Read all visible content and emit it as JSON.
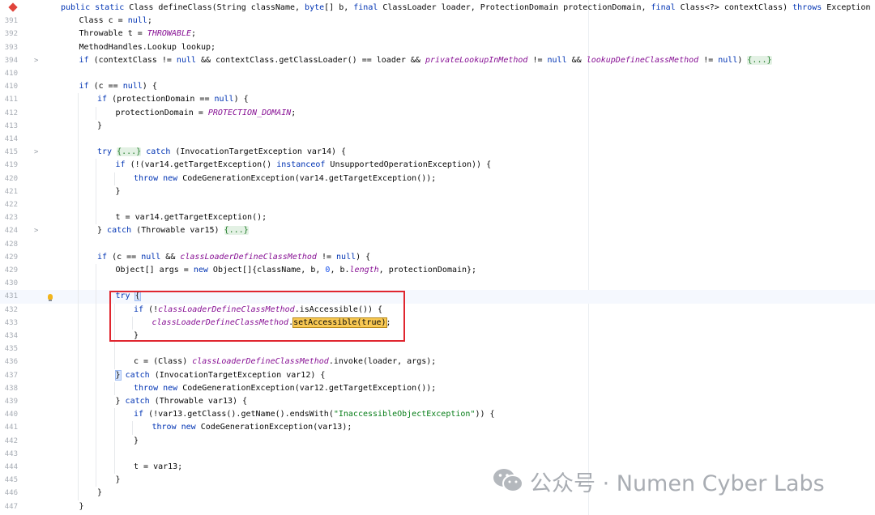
{
  "editor": {
    "language": "Java",
    "lines": [
      {
        "n": "",
        "segs": [
          [
            "kw",
            "public static "
          ],
          [
            "",
            "Class defineClass(String className, "
          ],
          [
            "kw",
            "byte"
          ],
          [
            "",
            "[] b, "
          ],
          [
            "kw",
            "final "
          ],
          [
            "",
            "ClassLoader loader, ProtectionDomain protectionDomain, "
          ],
          [
            "kw",
            "final "
          ],
          [
            "",
            "Class<?> contextClass) "
          ],
          [
            "kw",
            "throws "
          ],
          [
            "",
            "Exception {"
          ]
        ],
        "indent": 0
      },
      {
        "n": "391",
        "segs": [
          [
            "",
            "Class c = "
          ],
          [
            "kw",
            "null"
          ],
          [
            "",
            ";"
          ]
        ],
        "indent": 1
      },
      {
        "n": "392",
        "segs": [
          [
            "",
            "Throwable t = "
          ],
          [
            "const",
            "THROWABLE"
          ],
          [
            "",
            ";"
          ]
        ],
        "indent": 1
      },
      {
        "n": "393",
        "segs": [
          [
            "",
            "MethodHandles.Lookup lookup;"
          ]
        ],
        "indent": 1
      },
      {
        "n": "394",
        "fold": ">",
        "segs": [
          [
            "kw",
            "if "
          ],
          [
            "",
            "(contextClass != "
          ],
          [
            "kw",
            "null "
          ],
          [
            "",
            "&& contextClass.getClassLoader() == loader && "
          ],
          [
            "fld",
            "privateLookupInMethod"
          ],
          [
            "",
            " != "
          ],
          [
            "kw",
            "null "
          ],
          [
            "",
            "&& "
          ],
          [
            "fld",
            "lookupDefineClassMethod"
          ],
          [
            "",
            " != "
          ],
          [
            "kw",
            "null"
          ],
          [
            "",
            ") "
          ],
          [
            "fold",
            "{...}"
          ]
        ],
        "indent": 1
      },
      {
        "n": "410",
        "segs": [],
        "indent": 1
      },
      {
        "n": "410",
        "segs": [
          [
            "kw",
            "if "
          ],
          [
            "",
            "(c == "
          ],
          [
            "kw",
            "null"
          ],
          [
            "",
            ") {"
          ]
        ],
        "indent": 1
      },
      {
        "n": "411",
        "segs": [
          [
            "kw",
            "if "
          ],
          [
            "",
            "(protectionDomain == "
          ],
          [
            "kw",
            "null"
          ],
          [
            "",
            ") {"
          ]
        ],
        "indent": 2
      },
      {
        "n": "412",
        "segs": [
          [
            "",
            "protectionDomain = "
          ],
          [
            "const",
            "PROTECTION_DOMAIN"
          ],
          [
            "",
            ";"
          ]
        ],
        "indent": 3
      },
      {
        "n": "413",
        "segs": [
          [
            "",
            "}"
          ]
        ],
        "indent": 2
      },
      {
        "n": "414",
        "segs": [],
        "indent": 2
      },
      {
        "n": "415",
        "fold": ">",
        "segs": [
          [
            "kw",
            "try "
          ],
          [
            "fold",
            "{...}"
          ],
          [
            "",
            " "
          ],
          [
            "kw",
            "catch "
          ],
          [
            "",
            "(InvocationTargetException var14) {"
          ]
        ],
        "indent": 2
      },
      {
        "n": "419",
        "segs": [
          [
            "kw",
            "if "
          ],
          [
            "",
            "(!(var14.getTargetException() "
          ],
          [
            "kw",
            "instanceof "
          ],
          [
            "",
            "UnsupportedOperationException)) {"
          ]
        ],
        "indent": 3
      },
      {
        "n": "420",
        "segs": [
          [
            "kw",
            "throw new "
          ],
          [
            "",
            "CodeGenerationException(var14.getTargetException());"
          ]
        ],
        "indent": 4
      },
      {
        "n": "421",
        "segs": [
          [
            "",
            "}"
          ]
        ],
        "indent": 3
      },
      {
        "n": "422",
        "segs": [],
        "indent": 3
      },
      {
        "n": "423",
        "segs": [
          [
            "",
            "t = var14.getTargetException();"
          ]
        ],
        "indent": 3
      },
      {
        "n": "424",
        "fold": ">",
        "segs": [
          [
            "",
            "} "
          ],
          [
            "kw",
            "catch "
          ],
          [
            "",
            "(Throwable var15) "
          ],
          [
            "fold",
            "{...}"
          ]
        ],
        "indent": 2
      },
      {
        "n": "428",
        "segs": [],
        "indent": 2
      },
      {
        "n": "429",
        "segs": [
          [
            "kw",
            "if "
          ],
          [
            "",
            "(c == "
          ],
          [
            "kw",
            "null "
          ],
          [
            "",
            "&& "
          ],
          [
            "fld",
            "classLoaderDefineClassMethod"
          ],
          [
            "",
            " != "
          ],
          [
            "kw",
            "null"
          ],
          [
            "",
            ") {"
          ]
        ],
        "indent": 2
      },
      {
        "n": "429",
        "segs": [
          [
            "",
            "Object[] args = "
          ],
          [
            "kw",
            "new "
          ],
          [
            "",
            "Object[]{className, b, "
          ],
          [
            "num",
            "0"
          ],
          [
            "",
            ", b."
          ],
          [
            "fld",
            "length"
          ],
          [
            "",
            ", protectionDomain};"
          ]
        ],
        "indent": 3
      },
      {
        "n": "430",
        "segs": [],
        "indent": 3
      },
      {
        "n": "431",
        "current": true,
        "bulb": true,
        "segs": [
          [
            "kw",
            "try "
          ],
          [
            "brace",
            "{"
          ]
        ],
        "indent": 3
      },
      {
        "n": "432",
        "segs": [
          [
            "kw",
            "if "
          ],
          [
            "",
            "(!"
          ],
          [
            "fld",
            "classLoaderDefineClassMethod"
          ],
          [
            "",
            ".isAccessible()) {"
          ]
        ],
        "indent": 4
      },
      {
        "n": "433",
        "segs": [
          [
            "fld",
            "classLoaderDefineClassMethod"
          ],
          [
            "",
            "."
          ],
          [
            "hl",
            "setAccessible(true)"
          ],
          [
            "",
            ";"
          ]
        ],
        "indent": 5
      },
      {
        "n": "434",
        "segs": [
          [
            "",
            "}"
          ]
        ],
        "indent": 4
      },
      {
        "n": "435",
        "segs": [],
        "indent": 4
      },
      {
        "n": "436",
        "segs": [
          [
            "",
            "c = (Class) "
          ],
          [
            "fld",
            "classLoaderDefineClassMethod"
          ],
          [
            "",
            ".invoke(loader, args);"
          ]
        ],
        "indent": 4
      },
      {
        "n": "437",
        "segs": [
          [
            "brace",
            "}"
          ],
          [
            "",
            " "
          ],
          [
            "kw",
            "catch "
          ],
          [
            "",
            "(InvocationTargetException var12) {"
          ]
        ],
        "indent": 3
      },
      {
        "n": "438",
        "segs": [
          [
            "kw",
            "throw new "
          ],
          [
            "",
            "CodeGenerationException(var12.getTargetException());"
          ]
        ],
        "indent": 4
      },
      {
        "n": "439",
        "segs": [
          [
            "",
            "} "
          ],
          [
            "kw",
            "catch "
          ],
          [
            "",
            "(Throwable var13) {"
          ]
        ],
        "indent": 3
      },
      {
        "n": "440",
        "segs": [
          [
            "kw",
            "if "
          ],
          [
            "",
            "(!var13.getClass().getName().endsWith("
          ],
          [
            "str",
            "\"InaccessibleObjectException\""
          ],
          [
            "",
            ")) {"
          ]
        ],
        "indent": 4
      },
      {
        "n": "441",
        "segs": [
          [
            "kw",
            "throw new "
          ],
          [
            "",
            "CodeGenerationException(var13);"
          ]
        ],
        "indent": 5
      },
      {
        "n": "442",
        "segs": [
          [
            "",
            "}"
          ]
        ],
        "indent": 4
      },
      {
        "n": "443",
        "segs": [],
        "indent": 4
      },
      {
        "n": "444",
        "segs": [
          [
            "",
            "t = var13;"
          ]
        ],
        "indent": 4
      },
      {
        "n": "445",
        "segs": [
          [
            "",
            "}"
          ]
        ],
        "indent": 3
      },
      {
        "n": "446",
        "segs": [
          [
            "",
            "}"
          ]
        ],
        "indent": 2
      },
      {
        "n": "447",
        "segs": [
          [
            "",
            "}"
          ]
        ],
        "indent": 1
      }
    ]
  },
  "watermark": {
    "text": "公众号 · Numen Cyber Labs"
  },
  "colors": {
    "keyword": "#0033b3",
    "field": "#871094",
    "string": "#067d17",
    "number": "#1750eb",
    "highlight_box": "#e0262f"
  }
}
